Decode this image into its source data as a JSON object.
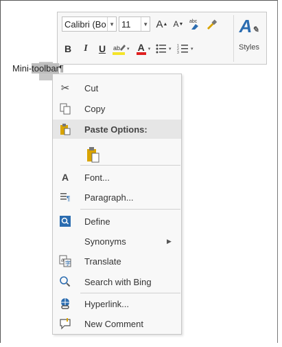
{
  "toolbar": {
    "font_name": "Calibri (Bo",
    "font_size": "11",
    "grow_font": "A",
    "shrink_font": "A",
    "bold": "B",
    "italic": "I",
    "underline": "U",
    "font_color_letter": "A",
    "styles_label": "Styles"
  },
  "doc": {
    "text_before": "Mini-",
    "text_selected": "toolbar",
    "pilcrow": "¶"
  },
  "menu": {
    "items": [
      {
        "label": "Cut",
        "icon": "scissors-icon"
      },
      {
        "label": "Copy",
        "icon": "copy-icon"
      },
      {
        "label": "Paste Options:",
        "icon": "paste-icon"
      },
      {
        "label": "Font...",
        "icon": "font-icon"
      },
      {
        "label": "Paragraph...",
        "icon": "paragraph-icon"
      },
      {
        "label": "Define",
        "icon": "define-icon"
      },
      {
        "label": "Synonyms",
        "icon": ""
      },
      {
        "label": "Translate",
        "icon": "translate-icon"
      },
      {
        "label": "Search with Bing",
        "icon": "search-icon"
      },
      {
        "label": "Hyperlink...",
        "icon": "hyperlink-icon"
      },
      {
        "label": "New Comment",
        "icon": "comment-icon"
      }
    ]
  },
  "colors": {
    "highlight": "#f5e428",
    "font_color": "#e02020",
    "accent_blue": "#2b6cb0"
  }
}
